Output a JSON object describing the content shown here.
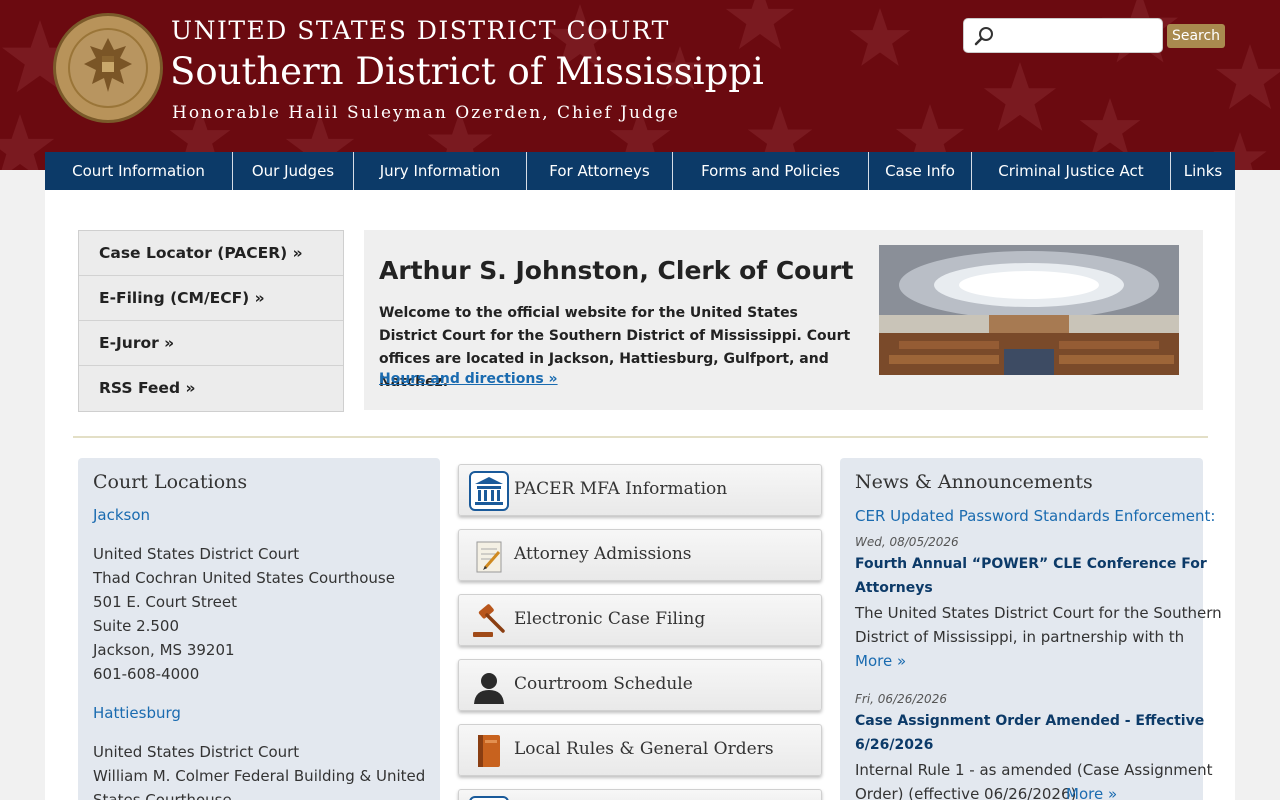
{
  "header": {
    "line1": "UNITED STATES DISTRICT COURT",
    "line2": "Southern District of Mississippi",
    "line3": "Honorable Halil Suleyman Ozerden, Chief Judge",
    "search_placeholder": "",
    "search_button": "Search",
    "colors": {
      "banner": "#6b0a10",
      "nav": "#0c3a68",
      "button": "#a98a4f"
    }
  },
  "nav": {
    "items": [
      "Court Information",
      "Our Judges",
      "Jury Information",
      "For Attorneys",
      "Forms and Policies",
      "Case Info",
      "Criminal Justice Act",
      "Links"
    ]
  },
  "quicklinks": [
    "Case Locator (PACER) »",
    "E-Filing (CM/ECF) »",
    "E-Juror »",
    "RSS Feed »"
  ],
  "welcome": {
    "title": "Arthur S. Johnston, Clerk of Court",
    "text": "Welcome to the official website for the United States District Court for the Southern District of Mississippi. Court offices are located in Jackson, Hattiesburg, Gulfport, and Natchez.",
    "link": "Hours and directions »"
  },
  "locations": {
    "title": "Court Locations",
    "jackson": {
      "city": "Jackson",
      "lines": [
        "United States District Court",
        "Thad Cochran United States Courthouse",
        "501 E. Court Street",
        "Suite 2.500",
        "Jackson, MS 39201",
        "601-608-4000"
      ]
    },
    "hattiesburg": {
      "city": "Hattiesburg",
      "lines": [
        "United States District Court",
        "William M. Colmer Federal Building & United",
        "States Courthouse"
      ]
    }
  },
  "services": [
    {
      "label": "PACER MFA Information",
      "icon": "courthouse-icon"
    },
    {
      "label": "Attorney Admissions",
      "icon": "document-pen-icon"
    },
    {
      "label": "Electronic Case Filing",
      "icon": "gavel-icon"
    },
    {
      "label": "Courtroom Schedule",
      "icon": "person-icon"
    },
    {
      "label": "Local Rules & General Orders",
      "icon": "book-icon"
    }
  ],
  "news": {
    "title": "News & Announcements",
    "items": [
      {
        "headline": "CER Updated Password Standards Enforcement:"
      },
      {
        "date": "Wed, 08/05/2026",
        "headline_l1": "Fourth Annual “POWER” CLE Conference For",
        "headline_l2": "Attorneys",
        "body_l1": "The United States District Court for the Southern",
        "body_l2": "District of Mississippi, in partnership with th",
        "more": "More »"
      },
      {
        "date": "Fri, 06/26/2026",
        "headline_l1": "Case Assignment Order Amended - Effective",
        "headline_l2": "6/26/2026",
        "body_l1": "Internal Rule 1 - as amended (Case Assignment",
        "body_l2": "Order) (effective 06/26/2026)",
        "more": "More »"
      }
    ]
  }
}
